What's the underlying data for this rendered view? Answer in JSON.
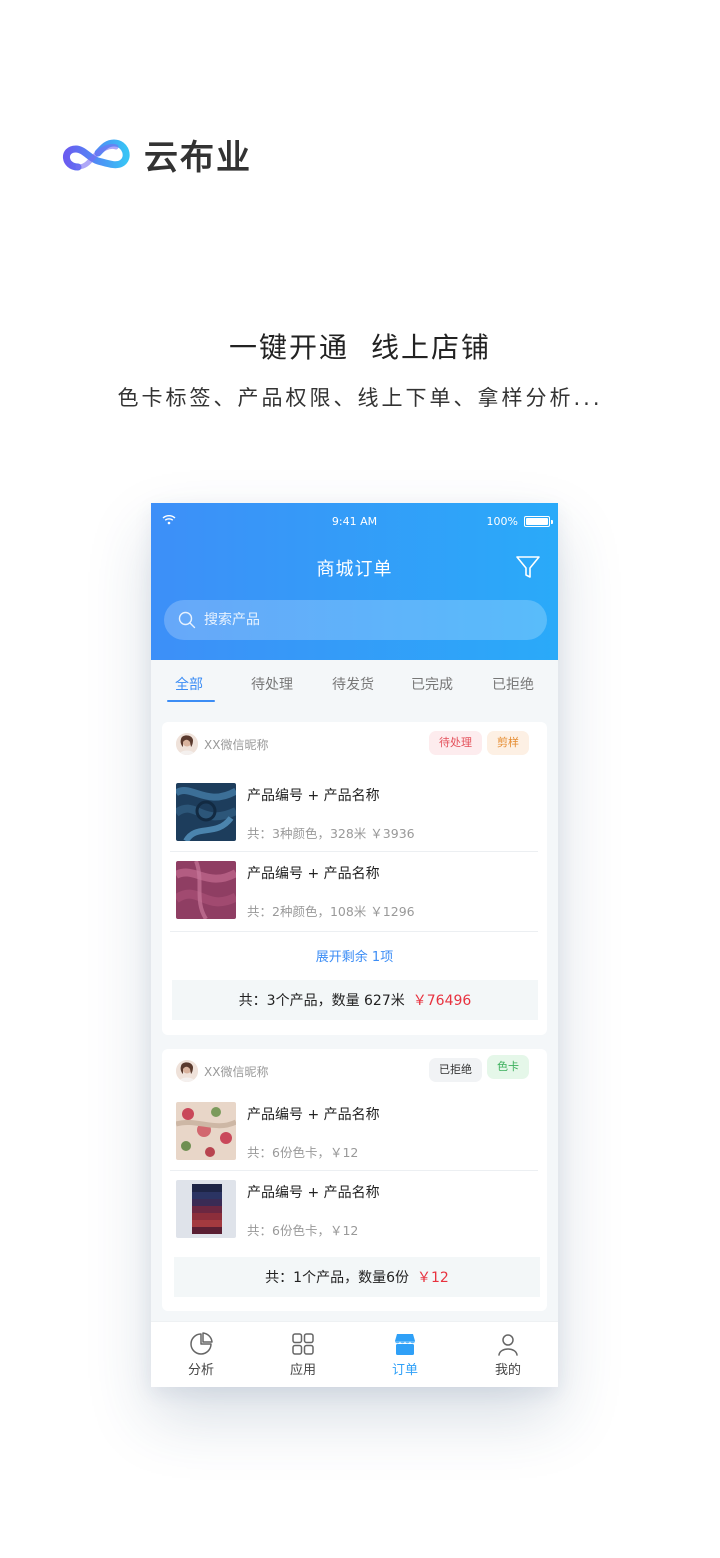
{
  "brand": {
    "name": "云布业",
    "logo_icon": "cloud-infinity-logo"
  },
  "hero": {
    "headline_1": "一键开通",
    "headline_2": "线上店铺",
    "subline": "色卡标签、产品权限、线上下单、拿样分析..."
  },
  "status_bar": {
    "time": "9:41 AM",
    "battery": "100%"
  },
  "header": {
    "title": "商城订单",
    "filter_icon": "filter-icon"
  },
  "search": {
    "placeholder": "搜索产品"
  },
  "tabs": [
    {
      "label": "全部",
      "active": true
    },
    {
      "label": "待处理",
      "active": false
    },
    {
      "label": "待发货",
      "active": false
    },
    {
      "label": "已完成",
      "active": false
    },
    {
      "label": "已拒绝",
      "active": false
    }
  ],
  "orders": [
    {
      "nickname": "XX微信昵称",
      "badges": [
        "待处理",
        "剪样"
      ],
      "items": [
        {
          "title": "产品编号 + 产品名称",
          "meta": "共：3种颜色，328米  ￥3936"
        },
        {
          "title": "产品编号 + 产品名称",
          "meta": "共：2种颜色，108米  ￥1296"
        }
      ],
      "expand": "展开剩余 1项",
      "summary": {
        "text": "共：3个产品，数量 627米",
        "price": "￥76496"
      }
    },
    {
      "nickname": "XX微信昵称",
      "badges": [
        "已拒绝",
        "色卡"
      ],
      "items": [
        {
          "title": "产品编号 + 产品名称",
          "meta": "共：6份色卡，￥12"
        },
        {
          "title": "产品编号 + 产品名称",
          "meta": "共：6份色卡，￥12"
        }
      ],
      "summary": {
        "text": "共：1个产品，数量6份",
        "price": "￥12"
      }
    }
  ],
  "tabbar": [
    {
      "label": "分析",
      "icon": "pie-chart-icon",
      "active": false
    },
    {
      "label": "应用",
      "icon": "grid-icon",
      "active": false
    },
    {
      "label": "订单",
      "icon": "store-icon",
      "active": true
    },
    {
      "label": "我的",
      "icon": "user-icon",
      "active": false
    }
  ],
  "colors": {
    "header_gradient_start": "#3d8ff8",
    "header_gradient_end": "#2aaaf9",
    "accent": "#3c8df5",
    "price_red": "#e8323f"
  }
}
